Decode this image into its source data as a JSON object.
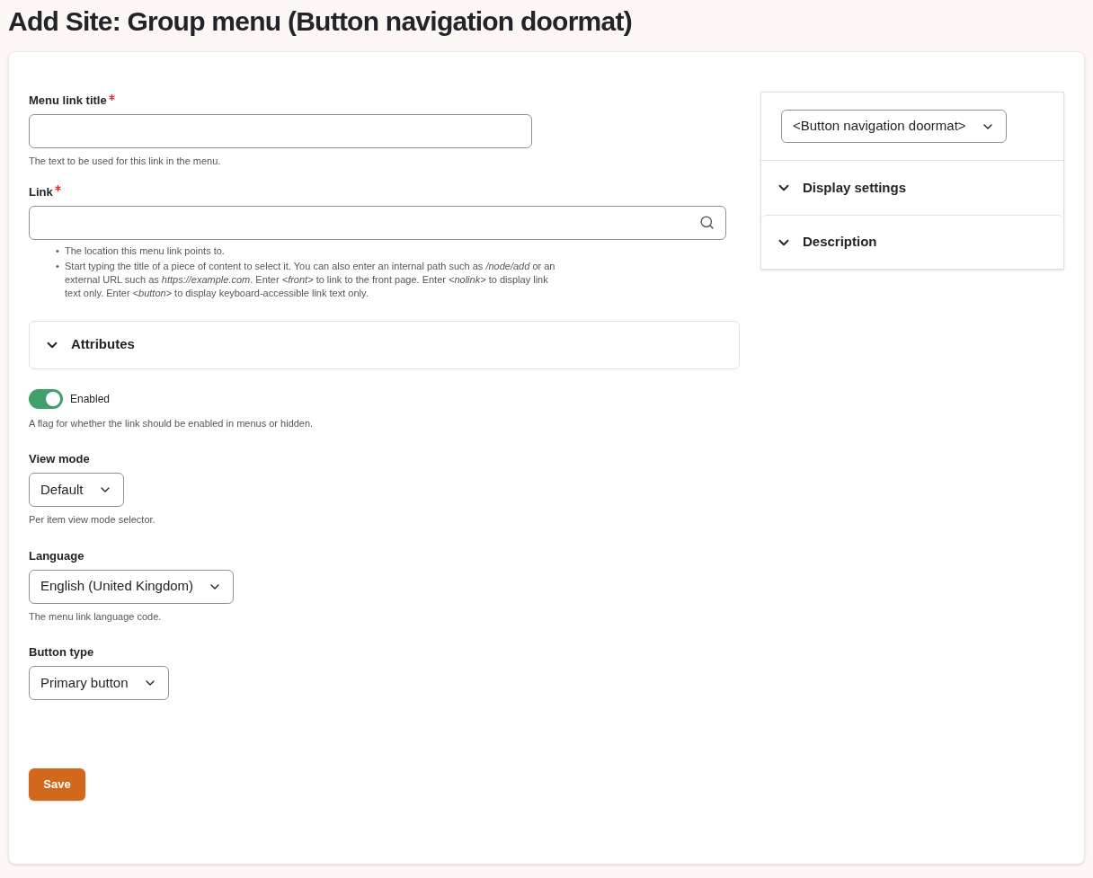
{
  "page_title": "Add Site: Group menu (Button navigation doormat)",
  "menu_link_title": {
    "label": "Menu link title",
    "required": true,
    "help": "The text to be used for this link in the menu."
  },
  "link": {
    "label": "Link",
    "required": true,
    "help": [
      {
        "marker": "•",
        "text": "The location this menu link points to."
      },
      {
        "marker": "•",
        "text": "Start typing the title of a piece of content to select it. You can also enter an internal path such as */node/add* or an external URL such as *https://example.com*. Enter *<front>* to link to the front page. Enter *<nolink>* to display link text only. Enter *<button>* to display keyboard-accessible link text only."
      }
    ]
  },
  "attributes": {
    "label": "Attributes",
    "expanded": false
  },
  "enabled": {
    "label": "Enabled",
    "on": true,
    "help": "A flag for whether the link should be enabled in menus or hidden."
  },
  "selects": [
    {
      "label": "View mode",
      "value": "Default",
      "help": "Per item view mode selector."
    },
    {
      "label": "Language",
      "value": "English (United Kingdom)",
      "help": "The menu link language code."
    },
    {
      "label": "Button type",
      "value": "Primary button"
    }
  ],
  "save_button": "Save",
  "sidebar": {
    "select": "<Button navigation doormat>",
    "sections": [
      {
        "label": "Display settings",
        "expanded": false
      },
      {
        "label": "Description",
        "expanded": false
      }
    ]
  }
}
